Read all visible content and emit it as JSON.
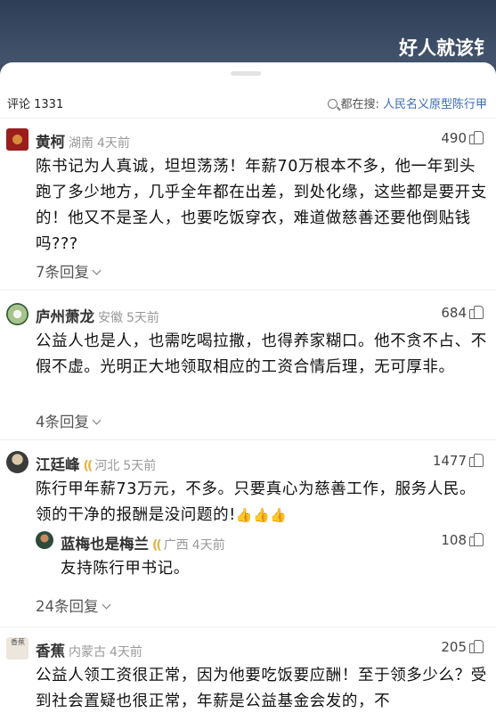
{
  "header": {
    "title": "好人就该钅"
  },
  "comments_header": {
    "count_label": "评论 1331",
    "search_prefix": "都在搜:",
    "search_keyword": "人民名义原型陈行甲"
  },
  "comments": [
    {
      "name": "黄柯",
      "region": "湖南",
      "time": "4天前",
      "likes": "490",
      "text": "陈书记为人真诚，坦坦荡荡！年薪70万根本不多，他一年到头跑了多少地方，几乎全年都在出差，到处化缘，这些都是要开支的！他又不是圣人，也要吃饭穿衣，难道做慈善还要他倒贴钱吗???",
      "replies": "7条回复"
    },
    {
      "name": "庐州萧龙",
      "region": "安徽",
      "time": "5天前",
      "likes": "684",
      "text": "公益人也是人，也需吃喝拉撒，也得养家糊口。他不贪不占、不假不虚。光明正大地领取相应的工资合情后理，无可厚非。",
      "replies": "4条回复"
    },
    {
      "name": "江廷峰",
      "region": "河北",
      "time": "5天前",
      "likes": "1477",
      "text": "陈行甲年薪73万元，不多。只要真心为慈善工作，服务人民。领的干净的报酬是没问题的!",
      "emoji": "👍👍👍",
      "reply": {
        "name": "蓝梅也是梅兰",
        "region": "广西",
        "time": "4天前",
        "likes": "108",
        "text": "友持陈行甲书记。"
      },
      "replies": "24条回复"
    },
    {
      "name": "香蕉",
      "region": "内蒙古",
      "time": "4天前",
      "likes": "205",
      "avatar_text": "香蕉",
      "text": "公益人领工资很正常，因为他要吃饭要应酬！至于领多少么？受到社会置疑也很正常，年薪是公益基金会发的，不"
    }
  ]
}
